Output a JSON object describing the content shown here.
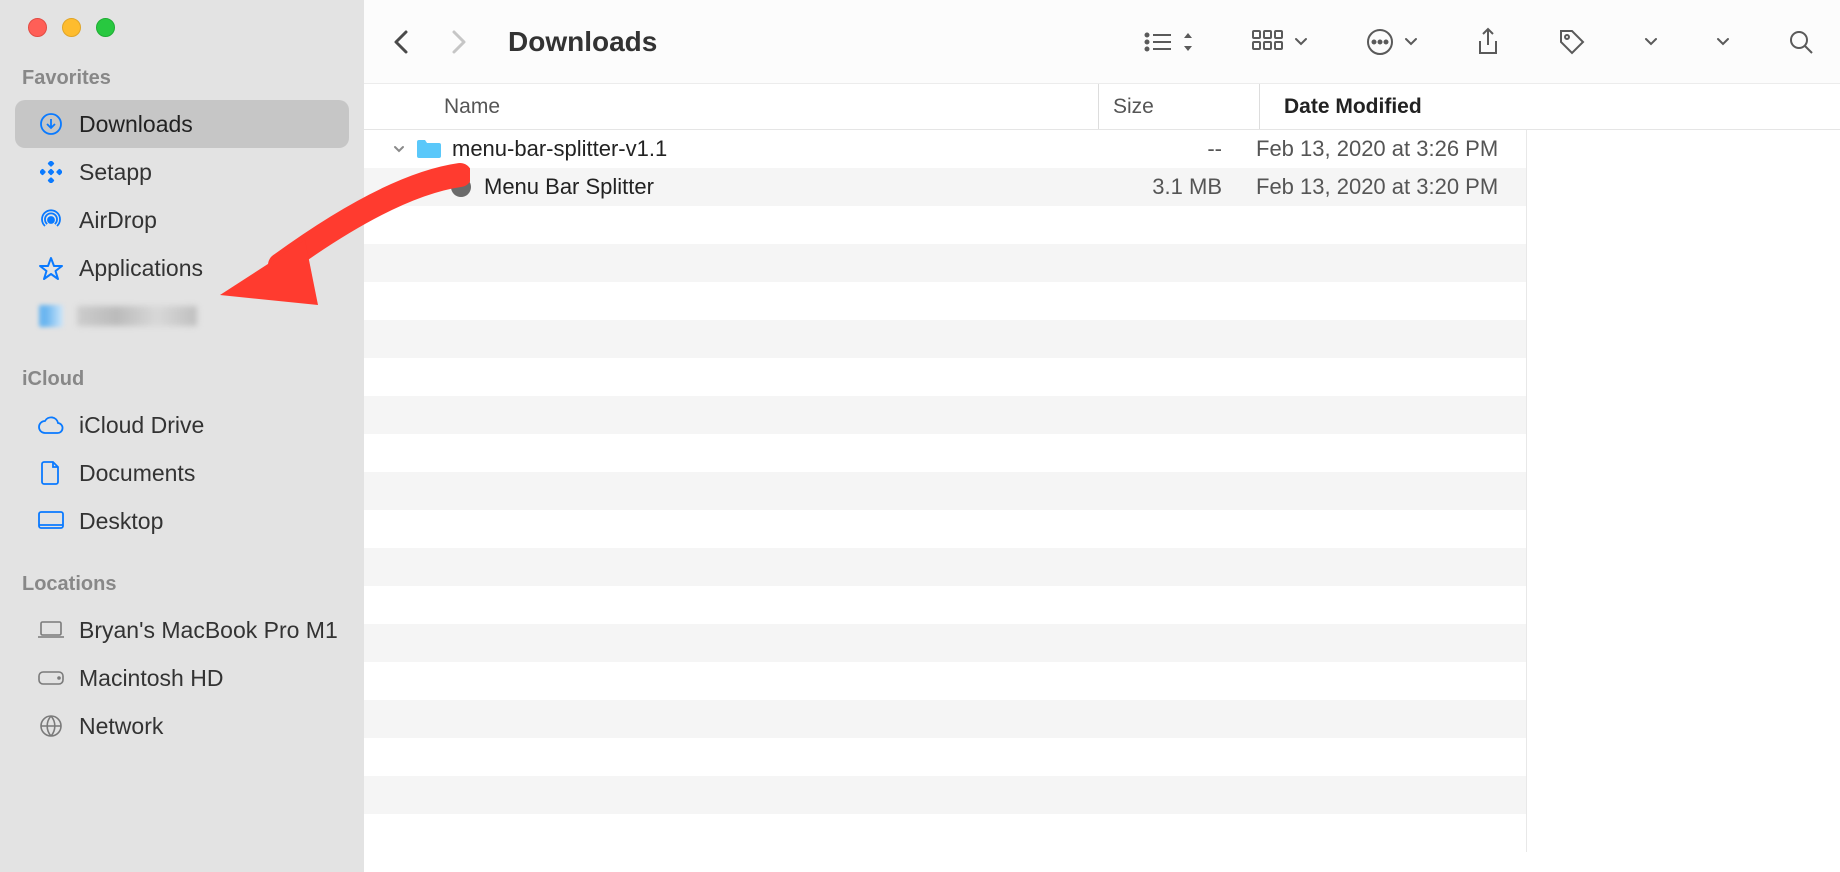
{
  "window_title": "Downloads",
  "sidebar": {
    "favorites_label": "Favorites",
    "icloud_label": "iCloud",
    "locations_label": "Locations",
    "favorites": [
      {
        "label": "Downloads",
        "selected": true,
        "icon": "download"
      },
      {
        "label": "Setapp",
        "selected": false,
        "icon": "setapp"
      },
      {
        "label": "AirDrop",
        "selected": false,
        "icon": "airdrop"
      },
      {
        "label": "Applications",
        "selected": false,
        "icon": "applications"
      },
      {
        "label": "",
        "selected": false,
        "icon": "blur"
      }
    ],
    "icloud": [
      {
        "label": "iCloud Drive",
        "icon": "cloud"
      },
      {
        "label": "Documents",
        "icon": "document"
      },
      {
        "label": "Desktop",
        "icon": "desktop"
      }
    ],
    "locations": [
      {
        "label": "Bryan's MacBook Pro M1",
        "icon": "laptop"
      },
      {
        "label": "Macintosh HD",
        "icon": "disk"
      },
      {
        "label": "Network",
        "icon": "globe"
      }
    ]
  },
  "columns": {
    "name": "Name",
    "size": "Size",
    "date": "Date Modified"
  },
  "files": [
    {
      "kind": "folder",
      "name": "menu-bar-splitter-v1.1",
      "size": "--",
      "date": "Feb 13, 2020 at 3:26 PM",
      "expanded": true,
      "indent": 0
    },
    {
      "kind": "app",
      "name": "Menu Bar Splitter",
      "size": "3.1 MB",
      "date": "Feb 13, 2020 at 3:20 PM",
      "indent": 1
    }
  ],
  "colors": {
    "accent": "#0A7AFF",
    "arrow_annotation": "#FF3B2F"
  }
}
